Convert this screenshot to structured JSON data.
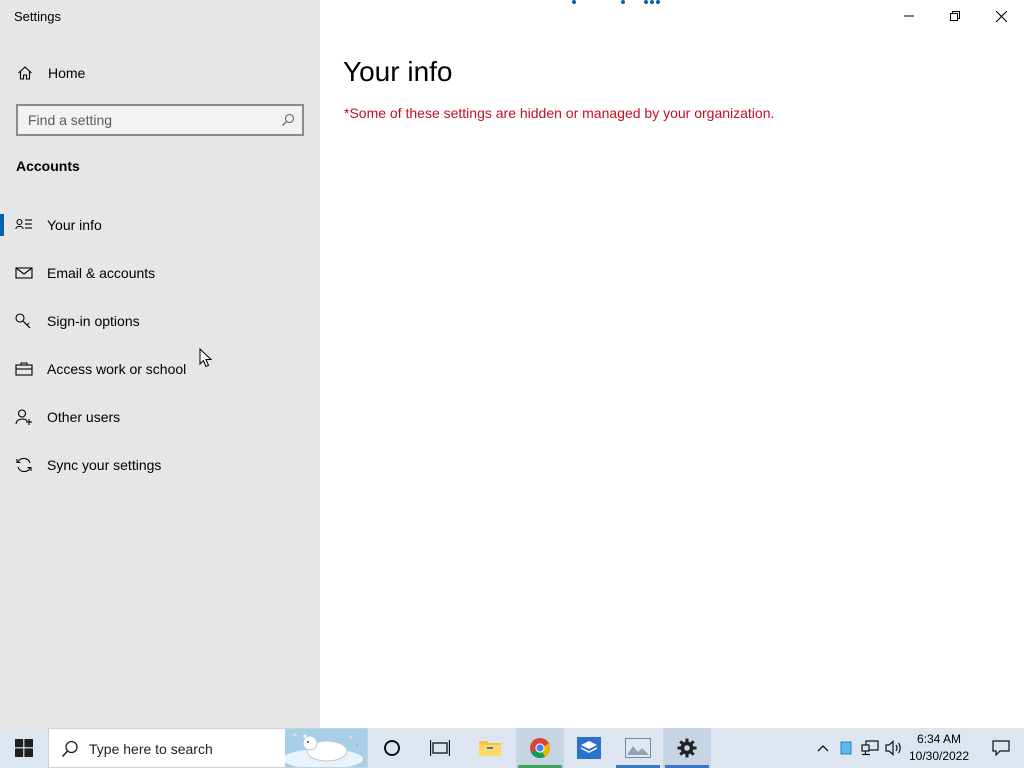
{
  "window": {
    "title": "Settings"
  },
  "sidebar": {
    "home_label": "Home",
    "search_placeholder": "Find a setting",
    "section_label": "Accounts",
    "items": [
      {
        "label": "Your info",
        "icon": "person-card-icon",
        "selected": true
      },
      {
        "label": "Email & accounts",
        "icon": "mail-icon",
        "selected": false
      },
      {
        "label": "Sign-in options",
        "icon": "key-icon",
        "selected": false
      },
      {
        "label": "Access work or school",
        "icon": "briefcase-icon",
        "selected": false
      },
      {
        "label": "Other users",
        "icon": "person-add-icon",
        "selected": false
      },
      {
        "label": "Sync your settings",
        "icon": "sync-icon",
        "selected": false
      }
    ]
  },
  "main": {
    "title": "Your info",
    "notice": "*Some of these settings are hidden or managed by your organization."
  },
  "taskbar": {
    "search_placeholder": "Type here to search",
    "time": "6:34 AM",
    "date": "10/30/2022"
  },
  "colors": {
    "accent": "#0063b1",
    "notice": "#c50f1f",
    "sidebar_bg": "#e6e6e6",
    "taskbar_bg": "#dde6f0"
  }
}
